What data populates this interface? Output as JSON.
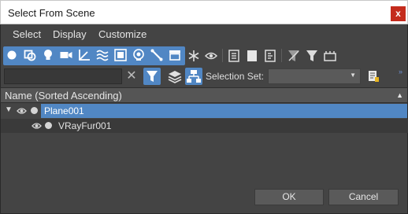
{
  "window": {
    "title": "Select From Scene",
    "close_glyph": "x"
  },
  "menu": [
    "Select",
    "Display",
    "Customize"
  ],
  "toolbar": {
    "type_filters": [
      "geometry-icon",
      "shapes-icon",
      "lights-icon",
      "cameras-icon",
      "helpers-icon",
      "spacewarps-icon",
      "groups-icon",
      "xrefs-icon",
      "bones-icon",
      "containers-icon"
    ],
    "display_toggles": [
      "frozen-snowflake-icon",
      "hidden-eye-icon"
    ],
    "select_buttons": [
      "select-all-icon",
      "select-none-icon",
      "select-invert-icon"
    ],
    "filter_buttons": [
      "filter-off-icon",
      "filter-icon",
      "presets-icon"
    ]
  },
  "search": {
    "value": "",
    "placeholder": ""
  },
  "selection_set": {
    "label": "Selection Set:",
    "value": ""
  },
  "accent_color": "#5187c4",
  "list": {
    "header": "Name (Sorted Ascending)",
    "rows": [
      {
        "name": "Plane001",
        "selected": true,
        "expanded": true,
        "level": 0
      },
      {
        "name": "VRayFur001",
        "selected": false,
        "level": 1
      }
    ]
  },
  "buttons": {
    "ok": "OK",
    "cancel": "Cancel"
  }
}
